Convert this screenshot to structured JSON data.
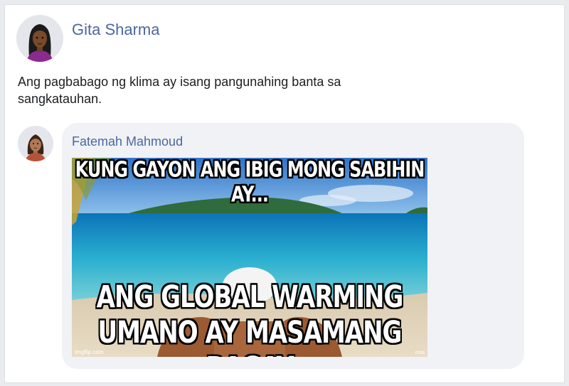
{
  "post": {
    "author": "Gita Sharma",
    "text": "Ang pagbabago ng klima ay isang pangunahing banta sa sangkatauhan."
  },
  "comment": {
    "author": "Fatemah Mahmoud",
    "meme": {
      "top_text": "KUNG GAYON ANG IBIG MONG SABIHIN AY...",
      "bottom_text": "ANG GLOBAL WARMING UMANO AY MASAMANG BAGAY",
      "watermark": "imgflip.com",
      "corner_mark": "mita"
    }
  },
  "colors": {
    "name_link": "#4b67a1",
    "bubble": "#f0f2f5"
  }
}
